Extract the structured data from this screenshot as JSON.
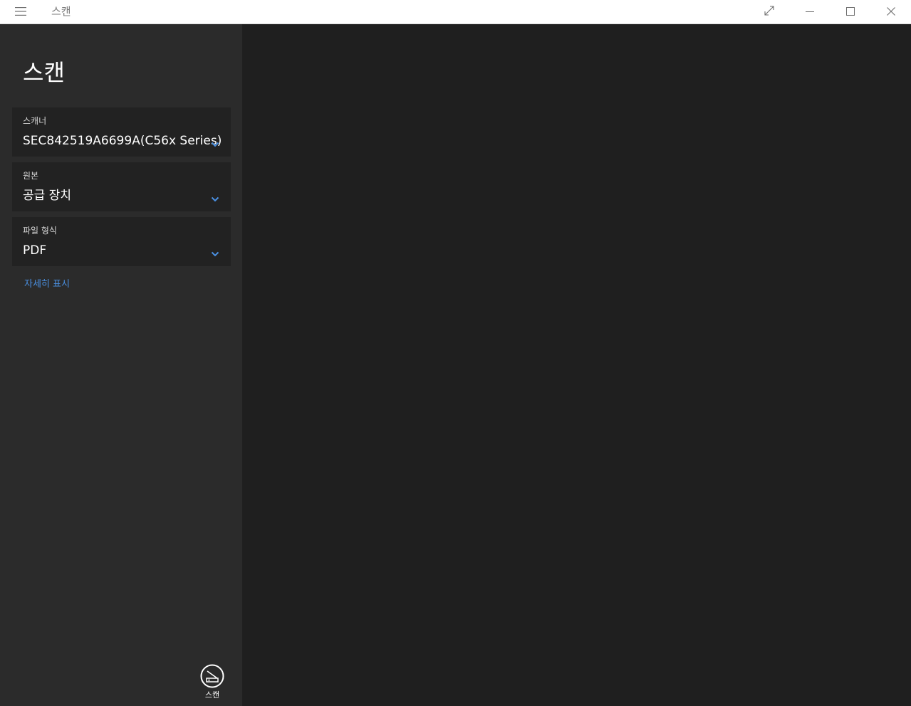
{
  "window": {
    "title": "스캔",
    "icons": {
      "menu": "hamburger-menu-icon",
      "fullscreen": "expand-icon",
      "minimize": "minimize-icon",
      "maximize": "maximize-icon",
      "close": "close-icon"
    }
  },
  "sidebar": {
    "heading": "스캔",
    "scanner": {
      "label": "스캐너",
      "value": "SEC842519A6699A(C56x Series)"
    },
    "source": {
      "label": "원본",
      "value": "공급 장치"
    },
    "file_type": {
      "label": "파일 형식",
      "value": "PDF"
    },
    "more_link": "자세히 표시",
    "scan_button": {
      "label": "스캔",
      "icon": "scanner-icon"
    }
  },
  "colors": {
    "accent": "#4a90e2",
    "sidebar_bg": "#2b2b2b",
    "main_bg": "#1f1f1f",
    "dropdown_bg": "#222222",
    "titlebar_bg": "#ffffff"
  }
}
